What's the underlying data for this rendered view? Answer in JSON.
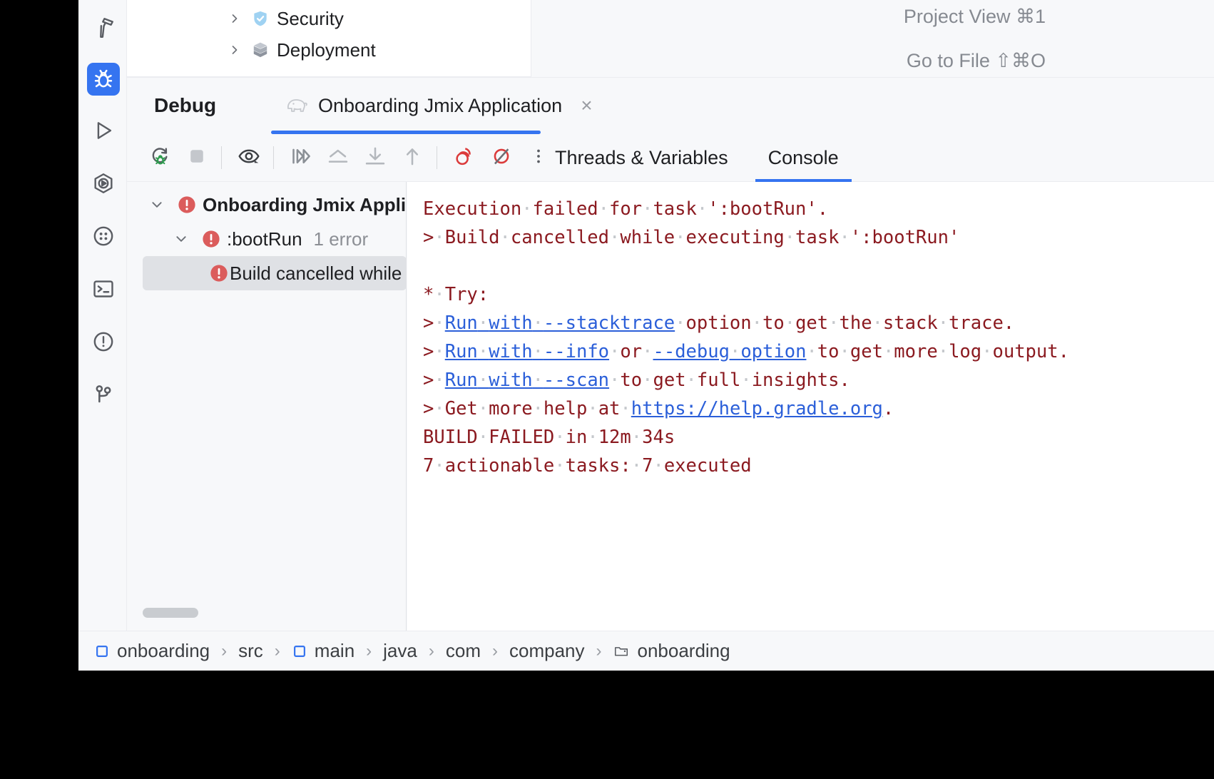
{
  "window": {
    "background": "#F7F8FA",
    "accent": "#3574F0",
    "error_color": "#DB5C5C",
    "console_text_color": "#8B1A20",
    "link_color": "#2B5FD9"
  },
  "tool_stripe": {
    "items": [
      {
        "name": "build",
        "icon": "hammer-icon",
        "active": false
      },
      {
        "name": "debug",
        "icon": "bug-icon",
        "active": true
      },
      {
        "name": "run",
        "icon": "play-icon",
        "active": false
      },
      {
        "name": "services",
        "icon": "hexagon-play-icon",
        "active": false
      },
      {
        "name": "endpoints",
        "icon": "dots-circle-icon",
        "active": false
      },
      {
        "name": "terminal",
        "icon": "terminal-icon",
        "active": false
      },
      {
        "name": "problems",
        "icon": "warning-circle-icon",
        "active": false
      },
      {
        "name": "git",
        "icon": "git-branch-icon",
        "active": false
      }
    ]
  },
  "editor_hints": {
    "project_view": "Project View ⌘1",
    "go_to_file": "Go to File ⇧⌘O"
  },
  "project_tree": {
    "nodes": [
      {
        "label": "Security",
        "icon": "shield-icon",
        "expanded": false
      },
      {
        "label": "Deployment",
        "icon": "package-icon",
        "expanded": false
      }
    ]
  },
  "debug": {
    "title": "Debug",
    "run_tab": {
      "label": "Onboarding Jmix Application",
      "icon": "jmix-elephant-icon",
      "close_label": "×",
      "active": true
    },
    "toolbar": {
      "buttons": [
        {
          "name": "rerun-debug",
          "icon": "rerun-bug-icon"
        },
        {
          "name": "stop",
          "icon": "stop-square-icon"
        },
        {
          "name": "view-breakpoints",
          "icon": "eye-icon"
        },
        {
          "name": "resume-program",
          "icon": "resume-icon"
        },
        {
          "name": "step-over",
          "icon": "step-over-icon"
        },
        {
          "name": "step-into",
          "icon": "step-into-icon"
        },
        {
          "name": "step-out",
          "icon": "step-out-icon"
        },
        {
          "name": "toggle-breakpoints",
          "icon": "breakpoint-icon"
        },
        {
          "name": "mute-breakpoints",
          "icon": "mute-breakpoint-icon"
        },
        {
          "name": "more-options",
          "icon": "more-vertical-icon"
        }
      ]
    },
    "subtabs": [
      {
        "label": "Threads & Variables",
        "active": false
      },
      {
        "label": "Console",
        "active": true
      }
    ],
    "build_tree": {
      "rows": [
        {
          "label": "Onboarding Jmix Application",
          "count": "",
          "level": 0,
          "expanded": true,
          "selected": false,
          "bold": true,
          "status": "error"
        },
        {
          "label": ":bootRun",
          "count": "1 error",
          "level": 1,
          "expanded": true,
          "selected": false,
          "bold": true,
          "status": "error"
        },
        {
          "label": "Build cancelled while executing task ':bootRun'",
          "count": "",
          "level": 2,
          "expanded": null,
          "selected": true,
          "bold": false,
          "status": "error"
        }
      ]
    },
    "console": {
      "lines": [
        {
          "segments": [
            {
              "t": "Execution failed for task ':bootRun'."
            }
          ]
        },
        {
          "segments": [
            {
              "t": "> Build cancelled while executing task ':bootRun'"
            }
          ]
        },
        {
          "blank": true
        },
        {
          "segments": [
            {
              "t": "* Try:"
            }
          ]
        },
        {
          "segments": [
            {
              "t": "> "
            },
            {
              "t": "Run with --stacktrace",
              "link": true
            },
            {
              "t": " option to get the stack trace."
            }
          ]
        },
        {
          "segments": [
            {
              "t": "> "
            },
            {
              "t": "Run with --info",
              "link": true
            },
            {
              "t": " or "
            },
            {
              "t": "--debug option",
              "link": true
            },
            {
              "t": " to get more log output."
            }
          ]
        },
        {
          "segments": [
            {
              "t": "> "
            },
            {
              "t": "Run with --scan",
              "link": true
            },
            {
              "t": " to get full insights."
            }
          ]
        },
        {
          "segments": [
            {
              "t": "> Get more help at "
            },
            {
              "t": "https://help.gradle.org",
              "link": true
            },
            {
              "t": "."
            }
          ]
        },
        {
          "segments": [
            {
              "t": "BUILD FAILED in 12m 34s"
            }
          ]
        },
        {
          "segments": [
            {
              "t": "7 actionable tasks: 7 executed"
            }
          ]
        }
      ]
    }
  },
  "breadcrumb": {
    "items": [
      {
        "label": "onboarding",
        "icon": "module-icon"
      },
      {
        "label": "src",
        "icon": ""
      },
      {
        "label": "main",
        "icon": "module-icon"
      },
      {
        "label": "java",
        "icon": ""
      },
      {
        "label": "com",
        "icon": ""
      },
      {
        "label": "company",
        "icon": ""
      },
      {
        "label": "onboarding",
        "icon": "folder-icon"
      }
    ],
    "separator": "›"
  }
}
